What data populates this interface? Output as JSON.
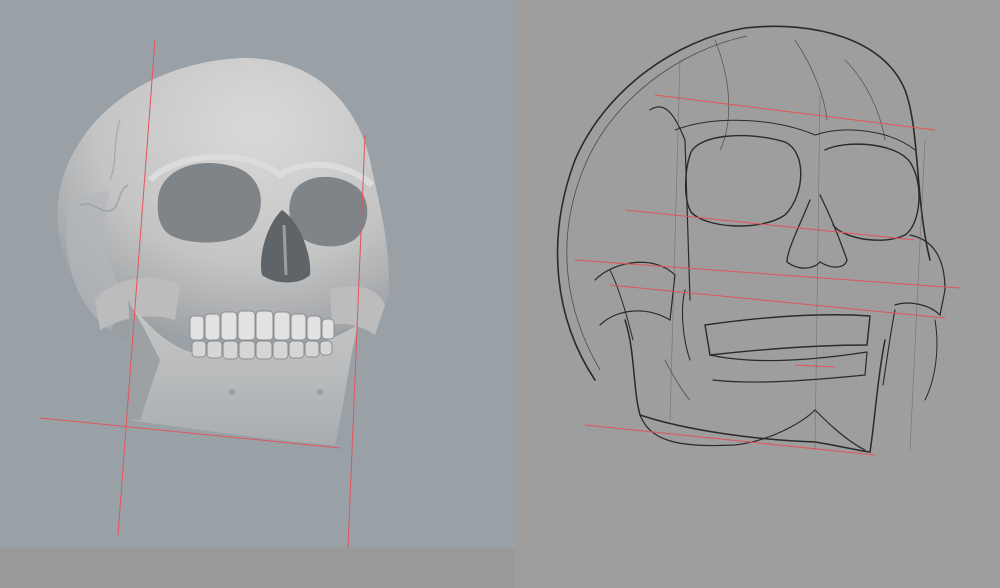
{
  "scene": {
    "left_panel": "3d-skull-render-with-guidelines",
    "right_panel": "pencil-sketch-of-skull-with-guidelines"
  },
  "colors": {
    "render_background": "#99a1a7",
    "sketch_background": "#9e9e9e",
    "bone": "#c6c6c6",
    "bone_shadow": "#7f8488",
    "guideline": "#e0555a",
    "pencil": "#2a2a2a"
  }
}
